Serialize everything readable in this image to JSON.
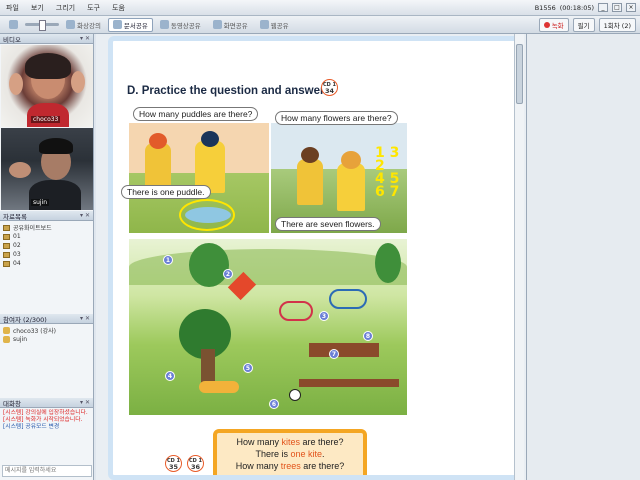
{
  "menu": {
    "items": [
      "파일",
      "보기",
      "그리기",
      "도구",
      "도움"
    ]
  },
  "status": {
    "session_id": "B1556",
    "timer": "(00:18:05)",
    "record_label": "녹화",
    "minimize": "_",
    "maximize": "□",
    "close": "×"
  },
  "toolbar": {
    "buttons": [
      "화상강의",
      "문서공유",
      "동영상공유",
      "화면공유",
      "웹공유"
    ],
    "active_index": 1,
    "right": {
      "record_label": "녹화",
      "board_label": "필기",
      "page_label": "1회차 (2)"
    }
  },
  "left_panel": {
    "video_header": "비디오",
    "video1_name": "choco33",
    "video2_name": "sujin",
    "files_header": "자료목록",
    "files": [
      "공유화이트보드",
      "01",
      "02",
      "03",
      "04"
    ],
    "participants_header": "참여자 (2/300)",
    "participants": [
      "choco33 (강사)",
      "sujin"
    ],
    "chat_header": "대화창",
    "chat": [
      {
        "text": "[시스템] 강의실에 입장하셨습니다.",
        "color": "red"
      },
      {
        "text": "[시스템] 녹화가 시작되었습니다.",
        "color": "red"
      },
      {
        "text": "[시스템] 공유모드 변경",
        "color": "blue"
      }
    ],
    "chat_placeholder": "메시지를 입력하세요"
  },
  "page": {
    "heading": "D. Practice the question and answer.",
    "badge_top": {
      "line1": "CD 1",
      "line2": "34"
    },
    "bubble_1": "How many puddles are there?",
    "bubble_2": "There is one puddle.",
    "bubble_3": "How many flowers are there?",
    "bubble_4": "There are seven flowers.",
    "numbers": [
      "1",
      "2",
      "3",
      "4",
      "5",
      "6",
      "7",
      "8"
    ],
    "badge_35": {
      "line1": "CD 1",
      "line2": "35"
    },
    "badge_36": {
      "line1": "CD 1",
      "line2": "36"
    },
    "qa": {
      "q1_a": "How many ",
      "q1_hl": "kites",
      "q1_b": " are there?",
      "a1_a": "There is ",
      "a1_hl": "one kite",
      "a1_b": ".",
      "q2_a": "How many ",
      "q2_hl": "trees",
      "q2_b": " are there?"
    }
  },
  "colors": {
    "accent": "#f4a623",
    "highlight": "#e2541c",
    "annotation": "#ffe600"
  }
}
